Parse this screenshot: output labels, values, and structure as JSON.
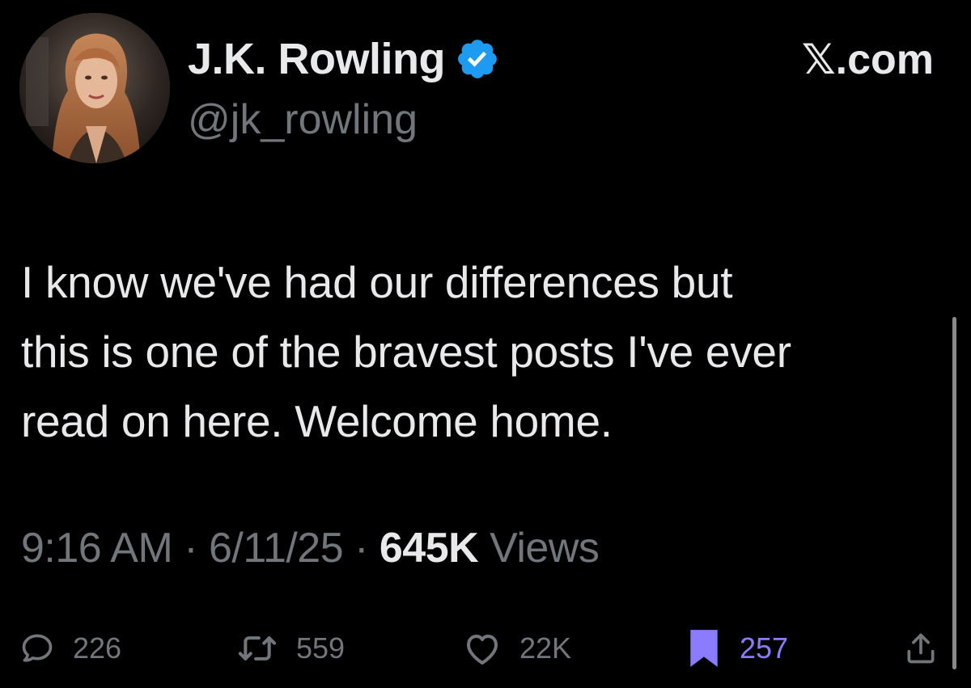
{
  "author": {
    "display_name": "J.K. Rowling",
    "handle": "@jk_rowling",
    "verified": true
  },
  "brand": "𝕏.com",
  "post": {
    "text": "I know we've had our differences but\nthis is one of the bravest posts I've ever\nread on here. Welcome home."
  },
  "meta": {
    "time": "9:16 AM",
    "separator": " · ",
    "date": "6/11/25",
    "views_count": "645K",
    "views_label": " Views"
  },
  "actions": {
    "replies": "226",
    "reposts": "559",
    "likes": "22K",
    "bookmarks": "257"
  },
  "colors": {
    "background": "#000000",
    "text_primary": "#e7e9ea",
    "text_secondary": "#71767b",
    "verified_blue": "#1d9bf0",
    "bookmark_active": "#8b7bff"
  },
  "icons": {
    "reply": "reply-icon",
    "repost": "repost-icon",
    "like": "heart-icon",
    "bookmark": "bookmark-icon",
    "share": "share-icon",
    "verified": "verified-badge-icon"
  }
}
